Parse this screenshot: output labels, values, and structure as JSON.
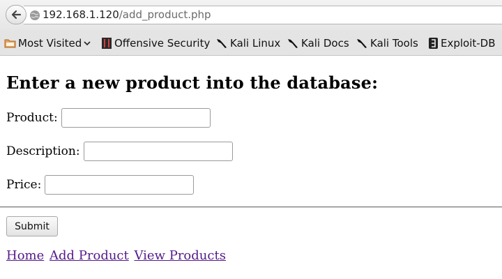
{
  "browser": {
    "url_host": "192.168.1.120",
    "url_path": "/add_product.php",
    "bookmarks": [
      {
        "label": "Most Visited",
        "icon": "folder-icon",
        "has_dropdown": true
      },
      {
        "label": "Offensive Security",
        "icon": "offsec-icon"
      },
      {
        "label": "Kali Linux",
        "icon": "kali-dragon-icon"
      },
      {
        "label": "Kali Docs",
        "icon": "kali-dragon-icon"
      },
      {
        "label": "Kali Tools",
        "icon": "kali-dragon-icon"
      },
      {
        "label": "Exploit-DB",
        "icon": "exploit-db-icon"
      }
    ]
  },
  "page": {
    "heading": "Enter a new product into the database:",
    "form": {
      "product_label": "Product:",
      "product_value": "",
      "description_label": "Description:",
      "description_value": "",
      "price_label": "Price:",
      "price_value": "",
      "submit_label": "Submit"
    },
    "nav_links": [
      "Home",
      "Add Product",
      "View Products"
    ]
  },
  "colors": {
    "visited_link": "#551a8b",
    "bookmark_bar": "#e4e4e4"
  }
}
